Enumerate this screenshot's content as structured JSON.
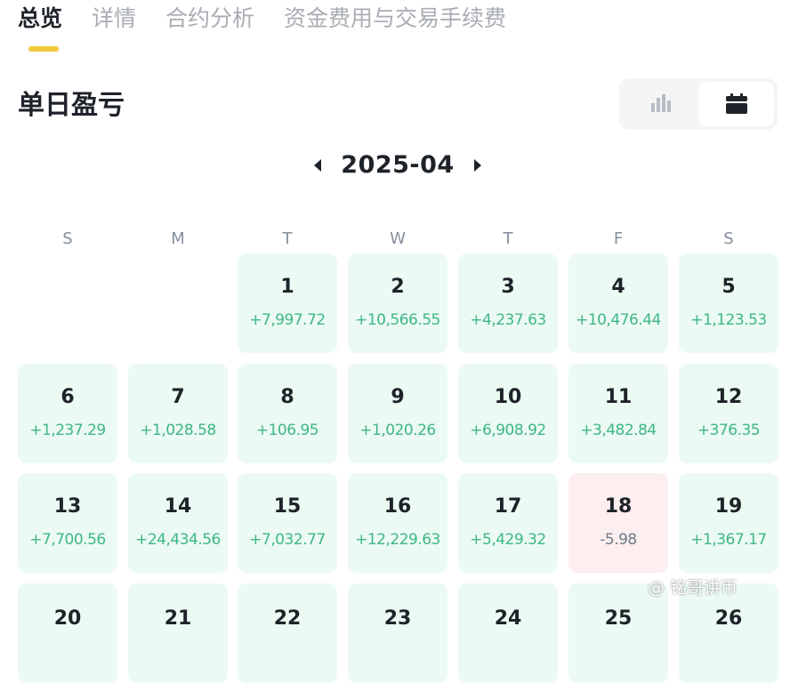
{
  "tabs": [
    {
      "label": "总览"
    },
    {
      "label": "详情"
    },
    {
      "label": "合约分析"
    },
    {
      "label": "资金费用与交易手续费"
    }
  ],
  "section_title": "单日盈亏",
  "view_toggle": {
    "options": [
      "bar-chart-icon",
      "calendar-icon"
    ],
    "selected": "calendar-icon"
  },
  "calendar": {
    "month": "2025-04",
    "weekdays": [
      "S",
      "M",
      "T",
      "W",
      "T",
      "F",
      "S"
    ],
    "days": [
      {
        "day": "1",
        "pnl": "+7,997.72"
      },
      {
        "day": "2",
        "pnl": "+10,566.55"
      },
      {
        "day": "3",
        "pnl": "+4,237.63"
      },
      {
        "day": "4",
        "pnl": "+10,476.44"
      },
      {
        "day": "5",
        "pnl": "+1,123.53"
      },
      {
        "day": "6",
        "pnl": "+1,237.29"
      },
      {
        "day": "7",
        "pnl": "+1,028.58"
      },
      {
        "day": "8",
        "pnl": "+106.95"
      },
      {
        "day": "9",
        "pnl": "+1,020.26"
      },
      {
        "day": "10",
        "pnl": "+6,908.92"
      },
      {
        "day": "11",
        "pnl": "+3,482.84"
      },
      {
        "day": "12",
        "pnl": "+376.35"
      },
      {
        "day": "13",
        "pnl": "+7,700.56"
      },
      {
        "day": "14",
        "pnl": "+24,434.56"
      },
      {
        "day": "15",
        "pnl": "+7,032.77"
      },
      {
        "day": "16",
        "pnl": "+12,229.63"
      },
      {
        "day": "17",
        "pnl": "+5,429.32"
      },
      {
        "day": "18",
        "pnl": "-5.98"
      },
      {
        "day": "19",
        "pnl": "+1,367.17"
      },
      {
        "day": "20",
        "pnl": ""
      },
      {
        "day": "21",
        "pnl": ""
      },
      {
        "day": "22",
        "pnl": ""
      },
      {
        "day": "23",
        "pnl": ""
      },
      {
        "day": "24",
        "pnl": ""
      },
      {
        "day": "25",
        "pnl": ""
      },
      {
        "day": "26",
        "pnl": ""
      }
    ]
  },
  "colors": {
    "profit_cell_bg": "#ebfaf2",
    "loss_cell_bg": "#fdeeef",
    "profit_text": "#3fb68b",
    "accent": "#f0c93a"
  },
  "watermark": "@ 铭哥讲币"
}
